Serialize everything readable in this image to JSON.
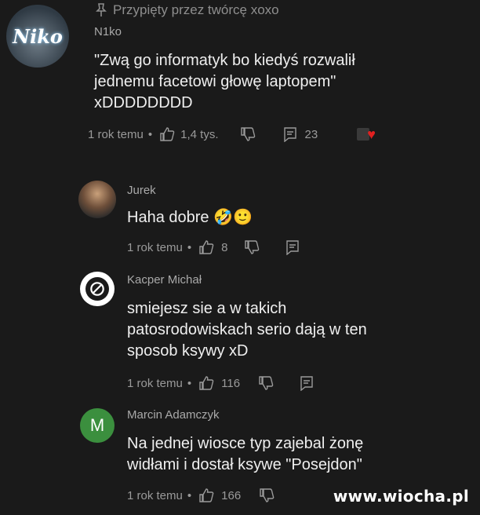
{
  "pinned": {
    "label": "Przypięty przez twórcę xoxo"
  },
  "comments": [
    {
      "author": "N1ko",
      "avatar_text": "Niko",
      "text_lines": [
        "\"Zwą go informatyk bo kiedyś rozwalił",
        "jednemu facetowi głowę laptopem\"",
        "xDDDDDDDD"
      ],
      "time": "1 rok temu",
      "likes": "1,4 tys.",
      "replies": "23",
      "heart": "creator-heart-icon"
    },
    {
      "author": "Jurek",
      "text_lines": [
        "Haha dobre"
      ],
      "emoji": "🤣🙂",
      "time": "1 rok temu",
      "likes": "8"
    },
    {
      "author": "Kacper Michał",
      "text_lines": [
        "smiejesz sie a w takich",
        "patosrodowiskach serio dają w ten",
        "sposob ksywy xD"
      ],
      "time": "1 rok temu",
      "likes": "116"
    },
    {
      "author": "Marcin Adamczyk",
      "avatar_letter": "M",
      "text_lines": [
        "Na jednej wiosce typ zajebal żonę",
        "widłami i dostał ksywe \"Posejdon\""
      ],
      "time": "1 rok temu",
      "likes": "166"
    }
  ],
  "separator": "•",
  "watermark": "www.wiocha.pl"
}
